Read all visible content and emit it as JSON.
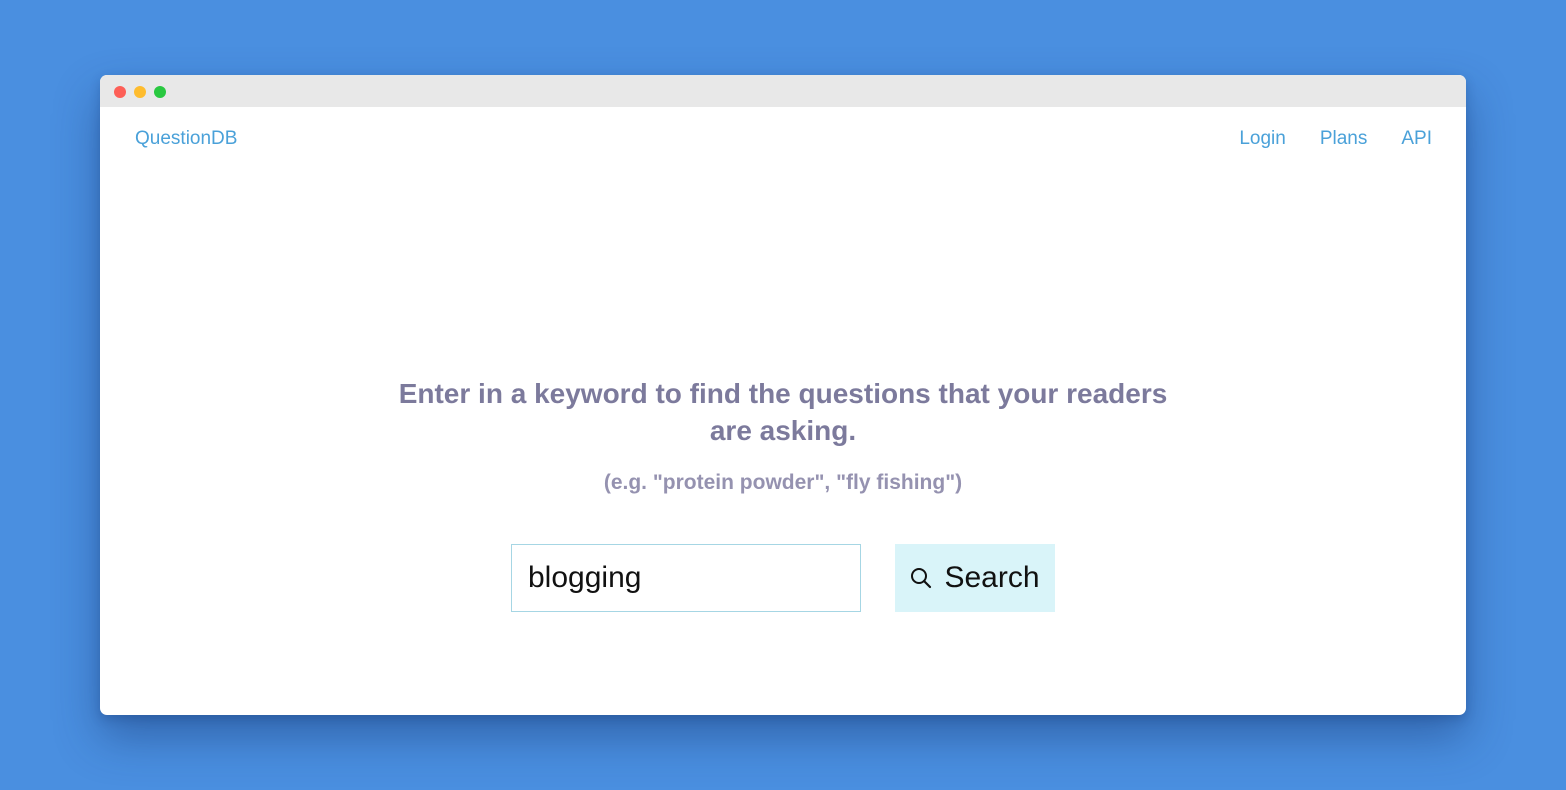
{
  "nav": {
    "brand": "QuestionDB",
    "links": [
      {
        "label": "Login"
      },
      {
        "label": "Plans"
      },
      {
        "label": "API"
      }
    ]
  },
  "hero": {
    "headline": "Enter in a keyword to find the questions that your readers are asking.",
    "example": "(e.g. \"protein powder\", \"fly fishing\")"
  },
  "search": {
    "value": "blogging",
    "placeholder": "",
    "button_label": "Search",
    "button_icon": "search-icon"
  },
  "colors": {
    "background": "#4a8fe0",
    "link": "#4aa1d9",
    "headline": "#7c7a9c",
    "button_bg": "#d9f4f9"
  }
}
